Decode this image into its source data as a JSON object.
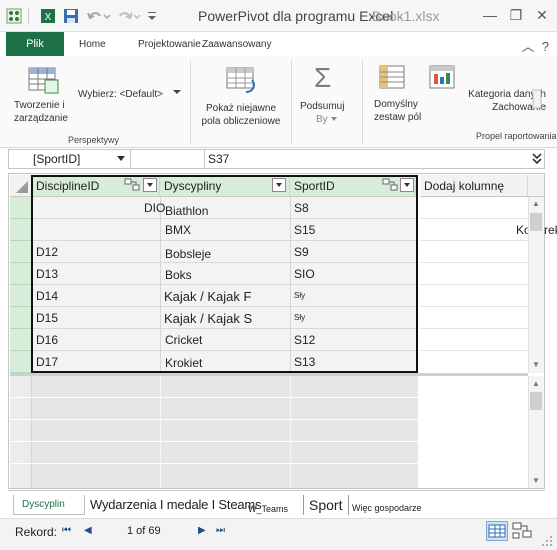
{
  "title": {
    "text": "PowerPivot dla programu Excel -",
    "ghost": "Book1.xlsx"
  },
  "tabs": {
    "file": "Plik",
    "home": "Home",
    "design": "Projektowanie",
    "advanced": "Zaawansowany"
  },
  "ribbon": {
    "create_manage": "Tworzenie i zarządzanie",
    "select_label": "Wybierz: <Default>",
    "perspectives_group": "Perspektywy",
    "show_implicit": "Pokaż niejawne pola obliczeniowe",
    "summarize_line1": "Podsumuj",
    "summarize_line2": "By",
    "default_fieldset": "Domyślny zestaw pól",
    "table_behavior": "Kategoria danych Zachowanie",
    "reporting_group": "Propel raportowania"
  },
  "formula_bar": {
    "name_box": "[SportID]",
    "value": "S37"
  },
  "grid": {
    "columns": [
      "DisciplineID",
      "Dyscypliny",
      "SportID",
      "Dodaj kolumnę"
    ],
    "rows": [
      {
        "id": "DIO",
        "name": "Biathlon",
        "sport": "S8"
      },
      {
        "id": "",
        "name": "BMX",
        "sport": "S15"
      },
      {
        "id": "D12",
        "name": "Bobsleje",
        "sport": "S9"
      },
      {
        "id": "D13",
        "name": "Boks",
        "sport": "SIO"
      },
      {
        "id": "D14",
        "name": "Kajak / Kajak F",
        "sport": "Sły"
      },
      {
        "id": "D15",
        "name": "Kajak / Kajak S",
        "sport": "Sły"
      },
      {
        "id": "D16",
        "name": "Cricket",
        "sport": "S12"
      },
      {
        "id": "D17",
        "name": "Krokiet",
        "sport": "S13"
      }
    ],
    "overflow_text": "Koperek"
  },
  "sheet_tabs": {
    "t1": "Dyscyplin",
    "t2": "Wydarzenia I medale I Steams",
    "t3": "W_Teams",
    "t4": "Sport",
    "t5": "Więc gospodarze"
  },
  "status": {
    "record_label": "Rekord:",
    "record_value": "1 of 69"
  },
  "colors": {
    "accent": "#1e7146",
    "selection": "#d7ecd9"
  }
}
